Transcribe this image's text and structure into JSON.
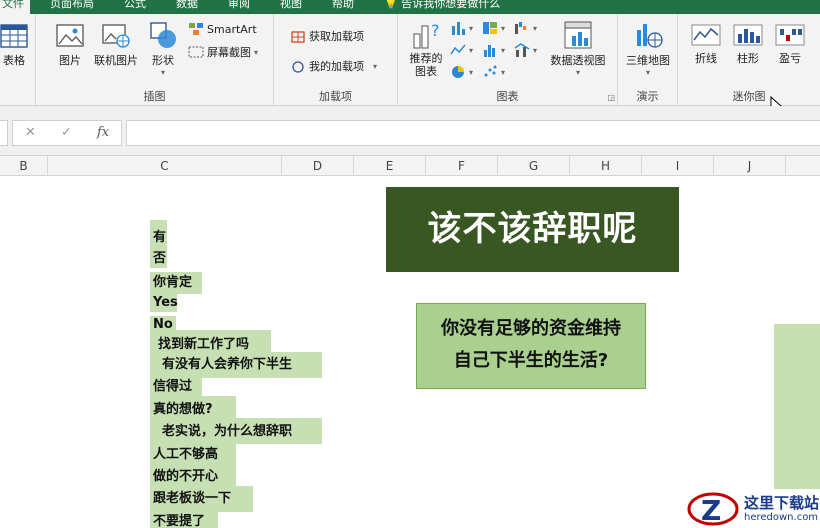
{
  "tabs": [
    "文件",
    "页面布局",
    "公式",
    "数据",
    "审阅",
    "视图",
    "帮助",
    "告诉我你想要做什么"
  ],
  "ribbon": {
    "tables": {
      "table_label": "表格"
    },
    "illustrations": {
      "label": "插图",
      "picture": "图片",
      "online_picture": "联机图片",
      "shapes": "形状",
      "smartart": "SmartArt",
      "screenshot": "屏幕截图"
    },
    "addins": {
      "label": "加载项",
      "get_addins": "获取加载项",
      "my_addins": "我的加载项"
    },
    "charts": {
      "label": "图表",
      "recommended": "推荐的图表",
      "pivot_chart": "数据透视图"
    },
    "tours": {
      "label": "演示",
      "map3d": "三维地图"
    },
    "sparklines": {
      "label": "迷你图",
      "line": "折线",
      "column": "柱形",
      "winloss": "盈亏"
    }
  },
  "formula_bar": {
    "cancel": "✕",
    "enter": "✓",
    "fx": "fx",
    "value": ""
  },
  "columns": [
    "B",
    "C",
    "D",
    "E",
    "F",
    "G",
    "H",
    "I",
    "J"
  ],
  "cells": [
    "有",
    "否",
    "你肯定",
    "Yes",
    "No",
    "找到新工作了吗",
    "有没有人会养你下半生",
    "信得过",
    "真的想做?",
    "老实说，为什么想辞职",
    "人工不够高",
    "做的不开心",
    "跟老板谈一下",
    "不要提了"
  ],
  "shapes": {
    "title": "该不该辞职呢",
    "question_line1": "你没有足够的资金维持",
    "question_line2": "自己下半生的生活?"
  },
  "watermark": {
    "title": "这里下载站",
    "url": "heredown.com"
  },
  "colors": {
    "excel_green": "#217346",
    "dark_green": "#385723",
    "mid_green": "#a9d08e",
    "light_green": "#c6e0b4"
  }
}
